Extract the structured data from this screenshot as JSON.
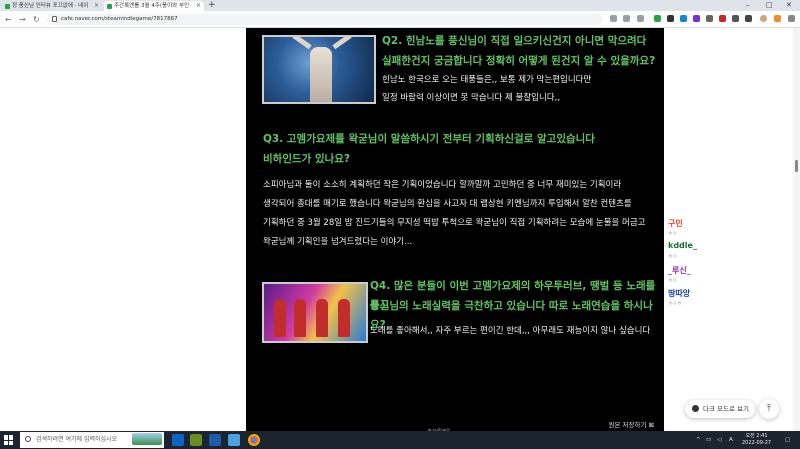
{
  "browser": {
    "tabs": [
      {
        "title": "정 풍신님 인터뷰 포끄없에 · 네이"
      },
      {
        "title": "주간록앤롤 3월 4주(풍이와 부인"
      }
    ],
    "url": "cafe.naver.com/steamindiegame/7817867",
    "window_controls": {
      "minimize": "–",
      "maximize": "□",
      "close": "✕"
    },
    "new_tab": "+"
  },
  "post": {
    "q2": {
      "question_line1": "Q2. 힌남노를 풍신님이 직접 일으키신건지 아니면 막으려다",
      "question_line2": "실패한건지 궁금합니다 정확히 어떻게 된건지 알 수 있을까요?",
      "answer_line1": "힌남노 한국으로 오는 태풍들은,, 보통 제가 막는편입니다만",
      "answer_line2": "일정 바람력 이상이면 못 막습니다 제 불찰입니다,,"
    },
    "q3": {
      "question_line1": "Q3. 고멤가요제를 왁굳님이 말씀하시기 전부터 기획하신걸로 알고있습니다",
      "question_line2": "비하인드가 있나요?",
      "answer_lines": [
        "소피아님과 둘이 소소히 계획하던 작은 기획이었습니다 할까말까 고민하던 중 너무 재미있는 기획이라",
        "생각되어 총대를 매기로 했습니다 왁굳님의 환심을 사고자 대 랩상현 키멘님까지 투입해서 알찬 컨텐츠를",
        "기획하던 중 3월 28일 밤 진드기들의 무지성 떡밥 투척으로 왁굳님이 직접 기획하려는 모습에 눈물을 머금고",
        "왁굳님께 기획인을 넘겨드렸다는 이야기..."
      ]
    },
    "q4": {
      "question_line1": "Q4. 많은 분들이 이번 고멤가요제의 하우투러브, 땡벌 등 노래를 듣고",
      "question_line2": "풍신님의 노래실력을 극찬하고 있습니다 따로 노래연습을 하시나요?",
      "answer_line1": "노래를 좋아해서,, 자주 부르는 편이긴 한데,,, 아무래도 재능이지 않나 싶습니다"
    },
    "source": "원본 저장하기 ⊠",
    "bottom_label": "- 주간록앤롤 -"
  },
  "sidebar": {
    "users": [
      {
        "name": "구민",
        "sub": "ㅎㅇ",
        "color": "#e0443a"
      },
      {
        "name": "kddle_",
        "sub": "ㅎㅇ",
        "color": "#1a6e2e"
      },
      {
        "name": "_루신_",
        "sub": "ㅎㅇ",
        "color": "#8a2fb0"
      },
      {
        "name": "땅따앙",
        "sub": "ㅎㅇㅎ",
        "color": "#1c3fa8"
      }
    ],
    "dark_mode_label": "다크 모드로 보기",
    "scroll_top": "⤒"
  },
  "taskbar": {
    "search_placeholder": "검색하려면 여기에 입력하십시오",
    "lang": "A",
    "clock_time": "오전 2:41",
    "clock_date": "2022-09-27"
  },
  "colors": {
    "question_green": "#61c463",
    "post_bg": "#000000",
    "answer_text": "#f2f2f2"
  }
}
